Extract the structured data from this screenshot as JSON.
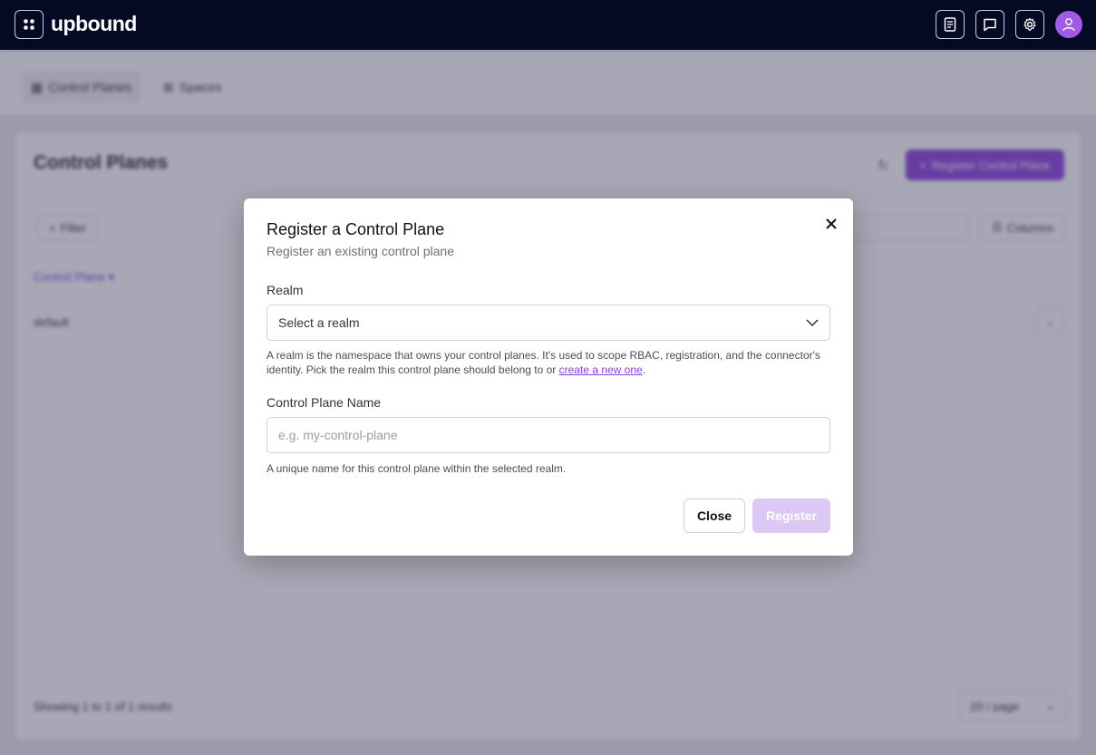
{
  "header": {
    "brand": "upbound",
    "icons": [
      "apps-grid-icon",
      "docs-icon",
      "chat-icon",
      "settings-icon",
      "user-icon"
    ]
  },
  "background": {
    "tabs": [
      {
        "label": "Control Planes",
        "icon": "grid-icon",
        "active": true
      },
      {
        "label": "Spaces",
        "icon": "spaces-icon",
        "active": false
      }
    ],
    "panel_title": "Control Planes",
    "primary_button": "Register Control Plane",
    "filter_label": "Filter",
    "columns_label": "Columns",
    "group_link": "Control Plane",
    "row_text": "default",
    "footer_text": "Showing 1 to 1 of 1 results",
    "per_page": "20 / page"
  },
  "modal": {
    "title": "Register a Control Plane",
    "subtitle": "Register an existing control plane",
    "realm": {
      "label": "Realm",
      "value": "Select a realm",
      "help_prefix": "A realm is the namespace that owns your control planes. It's used to scope RBAC, registration, and the connector's identity. Pick the realm this control plane should belong to or ",
      "help_link": "create a new one",
      "help_suffix": "."
    },
    "name": {
      "label": "Control Plane Name",
      "placeholder": "e.g. my-control-plane",
      "value": "",
      "help": "A unique name for this control plane within the selected realm."
    },
    "close_label": "Close",
    "register_label": "Register"
  },
  "colors": {
    "header_bg": "#050a24",
    "accent": "#8b3fe0",
    "register_disabled": "#dcc7f5",
    "avatar": "#a05ae6"
  }
}
